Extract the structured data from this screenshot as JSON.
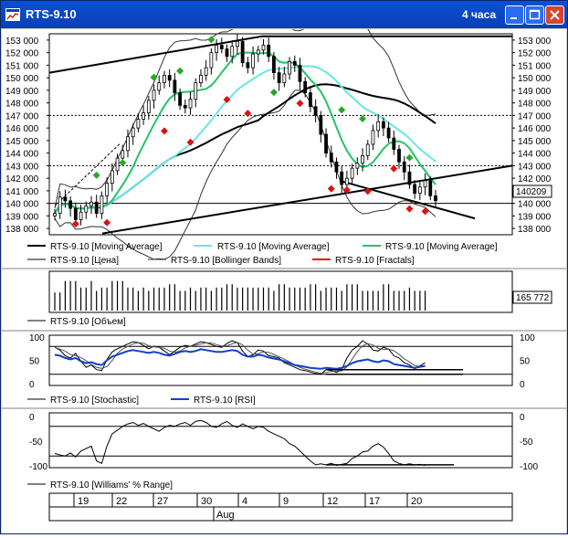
{
  "window": {
    "title": "RTS-9.10",
    "timeframe": "4 часа"
  },
  "colors": {
    "price_bg": "#ffffff",
    "ma_black": "#000000",
    "ma_cyan": "#66e6e6",
    "ma_green": "#22c466",
    "fractal_up": "#22aa22",
    "fractal_down": "#dd1111",
    "rsi": "#1040c8"
  },
  "price_panel": {
    "y_ticks": [
      "153 000",
      "152 000",
      "151 000",
      "150 000",
      "149 000",
      "148 000",
      "147 000",
      "146 000",
      "145 000",
      "144 000",
      "143 000",
      "142 000",
      "141 000",
      "140 000",
      "139 000",
      "138 000"
    ],
    "current_price": "140209",
    "legend": [
      {
        "label": "RTS-9.10 [Moving Average]"
      },
      {
        "label": "RTS-9.10 [Moving Average]"
      },
      {
        "label": "RTS-9.10 [Moving Average]"
      },
      {
        "label": "RTS-9.10 [Цена]"
      },
      {
        "label": "RTS-9.10 [Bollinger Bands]"
      },
      {
        "label": "RTS-9.10 [Fractals]"
      }
    ]
  },
  "volume_panel": {
    "current_value": "165 772",
    "legend": "RTS-9.10 [Объем]"
  },
  "oscillator_panel": {
    "y_ticks": [
      "100",
      "50",
      "0"
    ],
    "legend": [
      "RTS-9.10 [Stochastic]",
      "RTS-9.10 [RSI]"
    ]
  },
  "williams_panel": {
    "y_ticks": [
      "0",
      "-50",
      "-100"
    ],
    "legend": "RTS-9.10 [Williams' % Range]"
  },
  "time_axis": {
    "days": [
      "19",
      "22",
      "27",
      "30",
      "4",
      "9",
      "12",
      "17",
      "20"
    ],
    "month": "Aug"
  },
  "chart_data": {
    "type": "candlestick",
    "price": {
      "ylim": [
        137500,
        153500
      ],
      "closes": [
        139200,
        140500,
        140200,
        139600,
        138700,
        139300,
        139800,
        140100,
        139200,
        140600,
        141600,
        142600,
        143600,
        144200,
        145300,
        146000,
        146700,
        147200,
        148200,
        149000,
        149600,
        150200,
        149800,
        148800,
        147800,
        147600,
        148300,
        149600,
        150200,
        150800,
        152000,
        152600,
        152300,
        151700,
        152500,
        152900,
        151200,
        150800,
        151900,
        152200,
        152600,
        151700,
        150400,
        149600,
        150300,
        151300,
        151000,
        149700,
        148800,
        147700,
        147000,
        145500,
        144000,
        143300,
        142500,
        141500,
        142000,
        142800,
        143200,
        143800,
        144700,
        145800,
        146500,
        146000,
        145200,
        144300,
        143300,
        142500,
        141500,
        140800,
        141300,
        141800,
        140600,
        140209
      ],
      "fractals_up": [
        [
          8,
          141800
        ],
        [
          13,
          142800
        ],
        [
          19,
          149600
        ],
        [
          24,
          150100
        ],
        [
          30,
          152600
        ],
        [
          42,
          148400
        ],
        [
          55,
          147000
        ],
        [
          59,
          146300
        ],
        [
          68,
          143200
        ]
      ],
      "fractals_down": [
        [
          4,
          138800
        ],
        [
          10,
          138900
        ],
        [
          21,
          146200
        ],
        [
          26,
          145300
        ],
        [
          33,
          148700
        ],
        [
          37,
          147600
        ],
        [
          47,
          148400
        ],
        [
          53,
          141600
        ],
        [
          56,
          141500
        ],
        [
          60,
          141400
        ],
        [
          65,
          143200
        ],
        [
          68,
          140000
        ],
        [
          71,
          139800
        ]
      ]
    },
    "volume": [
      0.55,
      0.55,
      0.9,
      0.9,
      0.9,
      0.7,
      0.7,
      0.9,
      0.6,
      0.7,
      0.7,
      0.9,
      0.9,
      0.9,
      0.7,
      0.7,
      0.6,
      0.7,
      0.6,
      0.7,
      0.7,
      0.7,
      0.8,
      0.8,
      0.6,
      0.6,
      0.7,
      0.6,
      0.7,
      0.7,
      0.6,
      0.7,
      0.7,
      0.8,
      0.8,
      0.7,
      0.7,
      0.7,
      0.7,
      0.7,
      0.7,
      0.7,
      0.6,
      0.8,
      0.8,
      0.7,
      0.7,
      0.7,
      0.7,
      0.8,
      0.8,
      0.6,
      0.7,
      0.7,
      0.7,
      0.6,
      0.8,
      0.8,
      0.8,
      0.6,
      0.6,
      0.6,
      0.6,
      0.8,
      0.8,
      0.6,
      0.6,
      0.6,
      0.7,
      0.6,
      0.6,
      0.6
    ],
    "stochastic": [
      78,
      72,
      60,
      55,
      65,
      48,
      35,
      40,
      30,
      28,
      52,
      68,
      75,
      80,
      85,
      90,
      88,
      82,
      75,
      80,
      78,
      70,
      62,
      70,
      78,
      82,
      80,
      85,
      90,
      88,
      84,
      80,
      78,
      86,
      92,
      88,
      70,
      58,
      62,
      72,
      70,
      60,
      58,
      55,
      45,
      40,
      35,
      30,
      28,
      25,
      22,
      20,
      30,
      28,
      24,
      30,
      55,
      72,
      80,
      92,
      85,
      72,
      70,
      78,
      74,
      60,
      55,
      45,
      40,
      32,
      38,
      45
    ],
    "rsi": [
      62,
      60,
      55,
      52,
      55,
      48,
      44,
      46,
      42,
      40,
      50,
      58,
      62,
      66,
      70,
      72,
      70,
      68,
      66,
      68,
      66,
      62,
      60,
      64,
      68,
      70,
      68,
      70,
      74,
      72,
      70,
      68,
      68,
      70,
      72,
      70,
      62,
      58,
      58,
      62,
      60,
      56,
      54,
      52,
      48,
      44,
      40,
      38,
      36,
      34,
      33,
      32,
      34,
      33,
      32,
      34,
      38,
      44,
      48,
      50,
      52,
      48,
      46,
      50,
      48,
      42,
      40,
      38,
      36,
      34,
      36,
      38
    ],
    "williams": [
      -75,
      -78,
      -80,
      -74,
      -82,
      -70,
      -65,
      -60,
      -90,
      -95,
      -60,
      -35,
      -28,
      -20,
      -15,
      -12,
      -18,
      -14,
      -20,
      -25,
      -30,
      -22,
      -18,
      -20,
      -15,
      -12,
      -18,
      -10,
      -8,
      -12,
      -20,
      -22,
      -15,
      -10,
      -18,
      -22,
      -15,
      -20,
      -25,
      -20,
      -22,
      -30,
      -35,
      -40,
      -45,
      -55,
      -60,
      -70,
      -80,
      -90,
      -98,
      -96,
      -98,
      -95,
      -99,
      -97,
      -95,
      -85,
      -80,
      -72,
      -70,
      -60,
      -55,
      -62,
      -75,
      -90,
      -95,
      -98,
      -96,
      -98,
      -97,
      -99
    ]
  }
}
